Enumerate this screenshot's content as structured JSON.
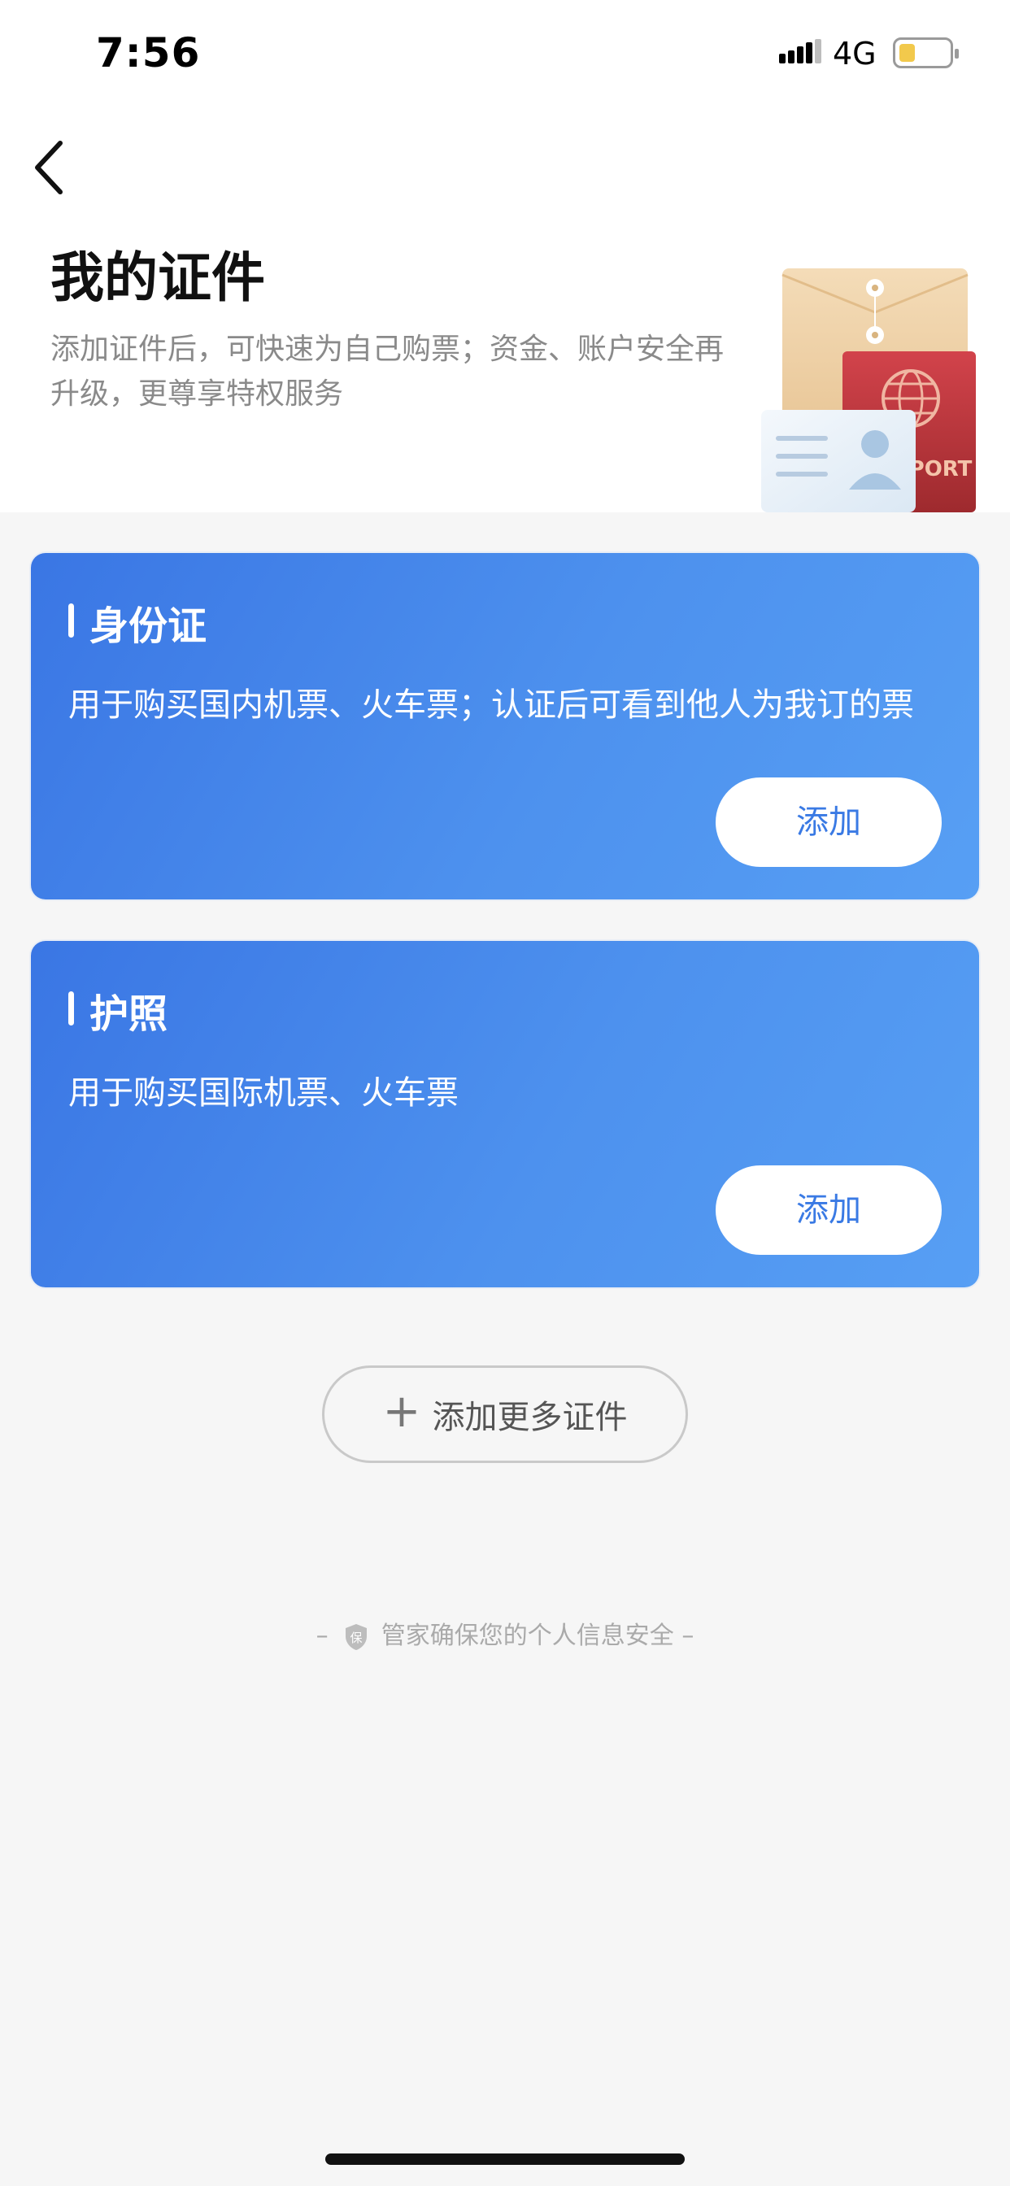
{
  "status_bar": {
    "time": "7:56",
    "network": "4G",
    "battery_level": 0.3
  },
  "header": {
    "back_icon": "chevron-left-icon",
    "title": "我的证件",
    "subtitle": "添加证件后，可快速为自己购票；资金、账户安全再升级，更尊享特权服务",
    "illustration_passport_text": "PASSPORT"
  },
  "cards": [
    {
      "title": "身份证",
      "description": "用于购买国内机票、火车票；认证后可看到他人为我订的票",
      "button": "添加"
    },
    {
      "title": "护照",
      "description": "用于购买国际机票、火车票",
      "button": "添加"
    }
  ],
  "more": {
    "icon": "plus-icon",
    "plus_glyph": "+",
    "label": "添加更多证件"
  },
  "footer": {
    "icon": "shield-icon",
    "shield_char": "保",
    "dash_left": "–",
    "text": "管家确保您的个人信息安全",
    "dash_right": "–"
  },
  "colors": {
    "card_gradient_start": "#3a76e4",
    "card_gradient_end": "#579ff4",
    "button_text": "#3a7ae4",
    "background": "#f6f6f6"
  }
}
